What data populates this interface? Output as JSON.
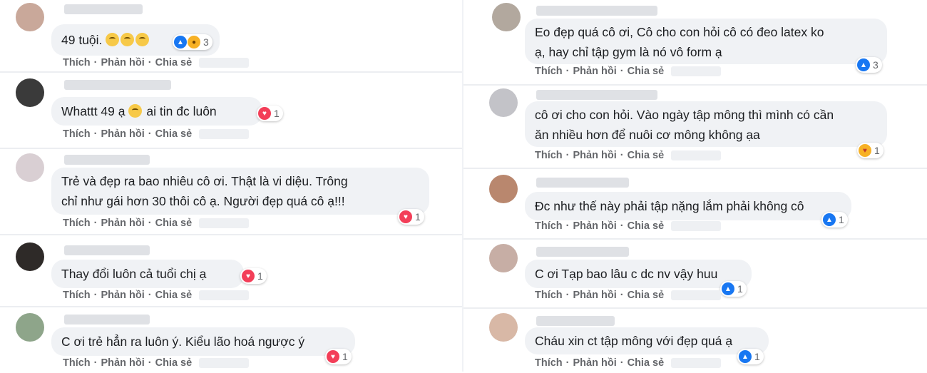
{
  "actions": {
    "like": "Thích",
    "reply": "Phản hồi",
    "share": "Chia sẻ",
    "dot": "·"
  },
  "left": [
    {
      "text": "49 tuội.",
      "emoji_count": 3,
      "reactions": [
        "like",
        "haha"
      ],
      "count": "3"
    },
    {
      "text": "Whattt 49 ạ",
      "text_after": "ai tin đc luôn",
      "emoji_count": 1,
      "reactions": [
        "love"
      ],
      "count": "1"
    },
    {
      "text": "Trẻ và đẹp ra bao nhiêu cô ơi. Thật là vi diệu. Trông\nchỉ như gái hơn 30 thôi cô ạ. Người đẹp quá cô ạ!!!",
      "reactions": [
        "love"
      ],
      "count": "1"
    },
    {
      "text": "Thay đổi luôn cả tuổi chị ạ",
      "reactions": [
        "love"
      ],
      "count": "1"
    },
    {
      "text": "C ơi trẻ hẳn ra luôn ý. Kiểu lão hoá ngược ý",
      "reactions": [
        "love"
      ],
      "count": "1"
    }
  ],
  "right": [
    {
      "text": "Eo đẹp quá cô ơi, Cô cho con hỏi cô có đeo latex ko\nạ, hay chỉ tập gym là nó vô form ạ",
      "reactions": [
        "like"
      ],
      "count": "3"
    },
    {
      "text": "cô ơi cho con hỏi. Vào ngày tập mông thì mình có cần\năn nhiều hơn để nuôi cơ mông không ạa",
      "reactions": [
        "care"
      ],
      "count": "1"
    },
    {
      "text": "Đc như thế này phải tập nặng lắm phải không cô",
      "reactions": [
        "like"
      ],
      "count": "1"
    },
    {
      "text": "C ơi Tạp bao lâu c dc nv vậy huu",
      "reactions": [
        "like"
      ],
      "count": "1"
    },
    {
      "text": "Cháu xin ct tập mông với đẹp quá ạ",
      "reactions": [
        "like"
      ],
      "count": "1"
    }
  ],
  "colors": {
    "bubble": "#f0f2f5",
    "text": "#1c1e21",
    "action": "#65676b",
    "like": "#1877f2",
    "love": "#f33e58",
    "haha": "#f7b125"
  },
  "icons": {
    "like": "thumbs-up-icon",
    "love": "heart-icon",
    "haha": "haha-icon",
    "care": "care-icon",
    "emoji": "crying-face-icon"
  }
}
